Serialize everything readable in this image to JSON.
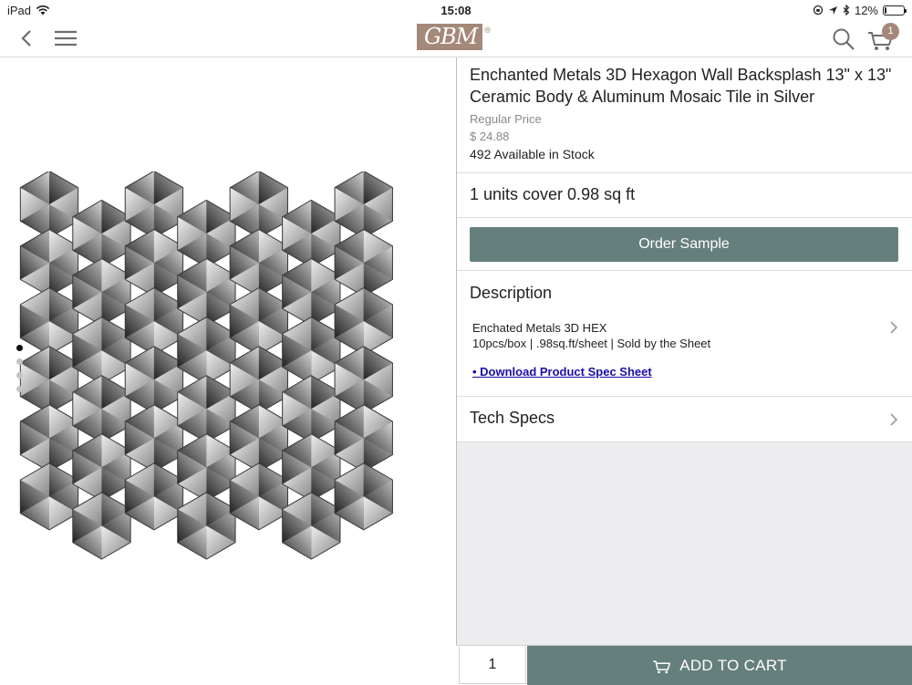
{
  "status_bar": {
    "device": "iPad",
    "time": "15:08",
    "battery": "12%",
    "battery_level": 0.12
  },
  "nav": {
    "logo_text": "GBM",
    "logo_reg": "®",
    "cart_count": "1",
    "icons": [
      "back-icon",
      "menu-icon",
      "search-icon",
      "cart-icon"
    ]
  },
  "gallery": {
    "dot_count": 4,
    "active_index": 0
  },
  "product": {
    "title": "Enchanted Metals 3D Hexagon Wall Backsplash 13\" x 13\" Ceramic Body & Aluminum Mosaic Tile in Silver",
    "regular_price_label": "Regular Price",
    "price": "$ 24.88",
    "stock": "492 Available in Stock",
    "coverage": "1 units cover 0.98 sq ft"
  },
  "order_sample_label": "Order Sample",
  "description": {
    "heading": "Description",
    "line1": "Enchated Metals 3D HEX",
    "line2": "10pcs/box | .98sq.ft/sheet | Sold by the Sheet",
    "link": "• Download Product Spec Sheet"
  },
  "tech_specs_label": "Tech Specs",
  "cart": {
    "quantity": "1",
    "add_label": "ADD TO CART"
  },
  "colors": {
    "accent": "#657f7d",
    "brand": "#a4887a",
    "link": "#1a0dab"
  }
}
